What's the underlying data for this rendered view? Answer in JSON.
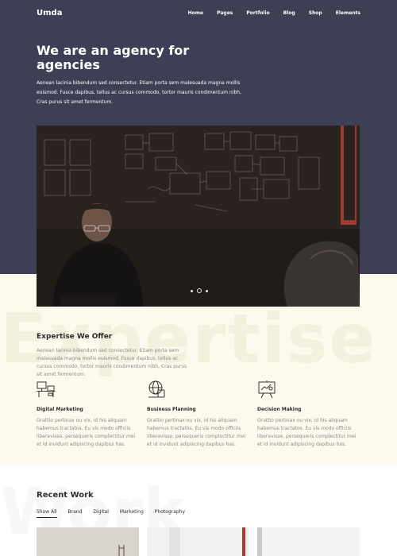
{
  "brand": "Umda",
  "nav": [
    "Home",
    "Pages",
    "Portfolio",
    "Blog",
    "Shop",
    "Elements"
  ],
  "hero": {
    "title": "We are an agency for agencies",
    "lead": "Aenean lacinia bibendum sed consectetur. Etiam porta sem malesuada magna mollis euismod. Fusce dapibus, tellus ac cursus commodo, tortor mauris condimentum nibh, Cras purus sit amet fermentum."
  },
  "slider": {
    "count": 3,
    "active_index": 1
  },
  "expertise": {
    "watermark": "Expertise",
    "title": "Expertise We Offer",
    "desc": "Aenean lacinia bibendum sed consectetur. Etiam porta sem malesuada magna mollis euismod. Fusce dapibus, tellus ac cursus commodo, tortor mauris condimentum nibh, Cras purus sit amet fermentum.",
    "features": [
      {
        "icon": "workstation-icon",
        "title": "Digital Marketing",
        "desc": "Orattio pertinax ou vix, id his aliquam habemus tractatos. Eu vis modo officiis liberavisse, persequeris complectitur mei et id invidunt adipiscing dapibus has."
      },
      {
        "icon": "globe-device-icon",
        "title": "Business Planning",
        "desc": "Orattio pertinax ou vix, id his aliquam habemus tractatos. Eu vis modo officiis liberavisse, persequeris complectitur mei et id invidunt adipiscing dapibus has."
      },
      {
        "icon": "presentation-board-icon",
        "title": "Decision Making",
        "desc": "Orattio pertinax ou vix, id his aliquam habemus tractatos. Eu vis modo officiis liberavisse, persequeris complectitur mei et id invidunt adipiscing dapibus has."
      }
    ]
  },
  "recent_work": {
    "watermark": "Work",
    "title": "Recent Work",
    "filters": [
      "Show All",
      "Brand",
      "Digital",
      "Marketing",
      "Photography"
    ],
    "active_filter": "Show All"
  }
}
